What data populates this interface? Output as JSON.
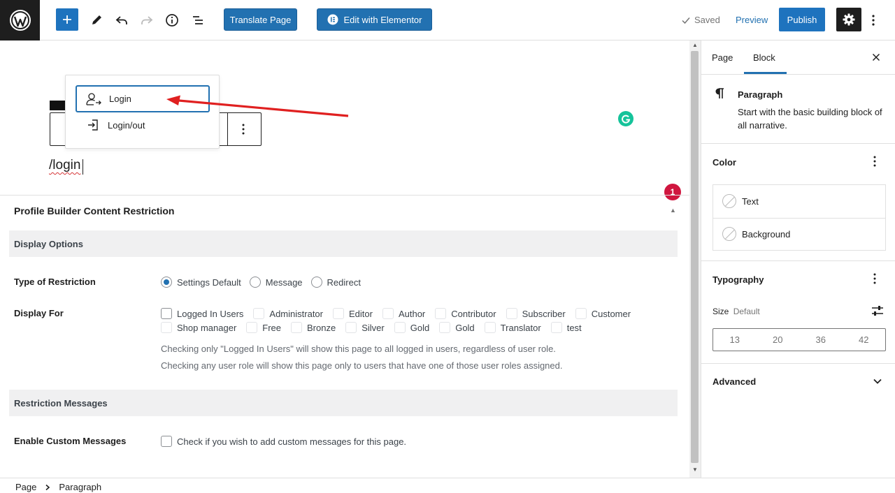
{
  "toolbar": {
    "translate_label": "Translate Page",
    "elementor_label": "Edit with Elementor",
    "saved_label": "Saved",
    "preview_label": "Preview",
    "publish_label": "Publish"
  },
  "inserter_popup": {
    "items": [
      {
        "label": "Login",
        "icon": "user-login-icon",
        "selected": true
      },
      {
        "label": "Login/out",
        "icon": "sign-in-icon",
        "selected": false
      }
    ]
  },
  "editor": {
    "slash_text": "/login",
    "notification_count": "1"
  },
  "metabox": {
    "title": "Profile Builder Content Restriction",
    "display_options": "Display Options",
    "type_label": "Type of Restriction",
    "restriction_types": [
      {
        "label": "Settings Default",
        "checked": true
      },
      {
        "label": "Message",
        "checked": false
      },
      {
        "label": "Redirect",
        "checked": false
      }
    ],
    "display_for_label": "Display For",
    "roles_row1": [
      "Logged In Users",
      "Administrator",
      "Editor",
      "Author",
      "Contributor",
      "Subscriber",
      "Customer"
    ],
    "roles_row2": [
      "Shop manager",
      "Free",
      "Bronze",
      "Silver",
      "Gold",
      "Gold",
      "Translator",
      "test"
    ],
    "help1": "Checking only \"Logged In Users\" will show this page to all logged in users, regardless of user role.",
    "help2": "Checking any user role will show this page only to users that have one of those user roles assigned.",
    "restriction_messages": "Restriction Messages",
    "custom_label": "Enable Custom Messages",
    "custom_check": "Check if you wish to add custom messages for this page."
  },
  "sidebar": {
    "tabs": [
      "Page",
      "Block"
    ],
    "active_tab": "Block",
    "block_title": "Paragraph",
    "block_desc_line1": "Start with the basic building block of",
    "block_desc_line2": "all narrative.",
    "color_heading": "Color",
    "color_text": "Text",
    "color_background": "Background",
    "typography_heading": "Typography",
    "size_label": "Size",
    "size_value": "Default",
    "sizes": [
      "13",
      "20",
      "36",
      "42"
    ],
    "advanced_heading": "Advanced"
  },
  "breadcrumb": {
    "root": "Page",
    "current": "Paragraph"
  },
  "colors": {
    "accent": "#2271b1",
    "arrow": "#e02020",
    "grammarly": "#15c39a",
    "badge": "#d0163f"
  }
}
